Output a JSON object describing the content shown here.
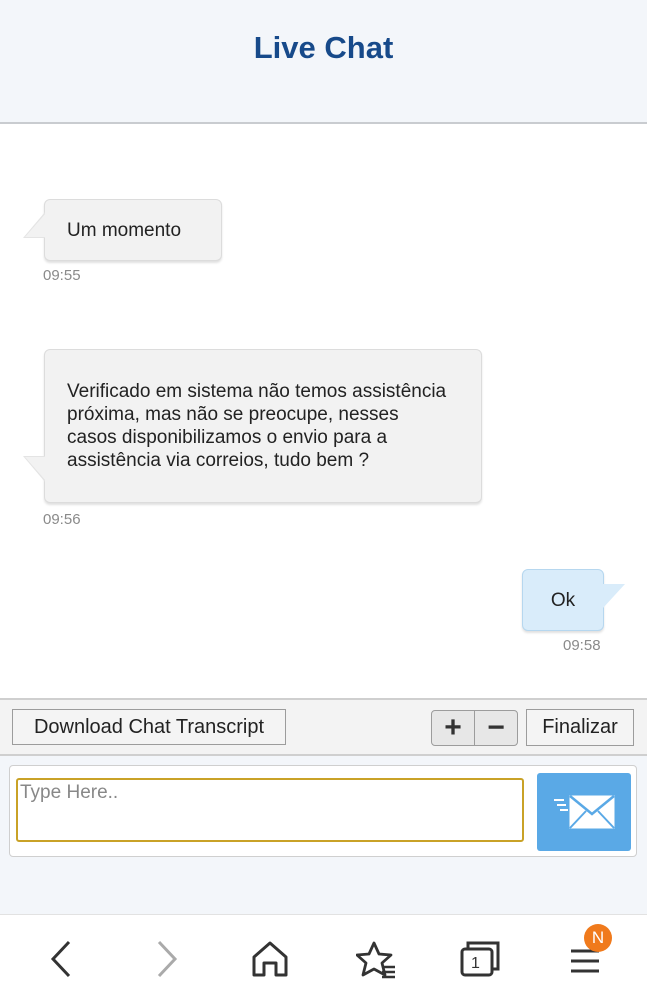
{
  "header": {
    "title": "Live Chat"
  },
  "messages": [
    {
      "sender": "agent",
      "text": "Um momento",
      "time": "09:55"
    },
    {
      "sender": "agent",
      "text": "Verificado em sistema não temos assistência próxima, mas não se preocupe, nesses casos disponibilizamos o envio para a assistência via correios, tudo bem ?",
      "time": "09:56"
    },
    {
      "sender": "user",
      "text": "Ok",
      "time": "09:58"
    }
  ],
  "toolbar": {
    "download_label": "Download Chat Transcript",
    "zoom_in_label": "+",
    "zoom_out_label": "−",
    "end_label": "Finalizar"
  },
  "composer": {
    "placeholder": "Type Here..",
    "value": "",
    "send_icon": "send-mail-icon"
  },
  "browser_nav": {
    "icons": [
      "back-icon",
      "forward-icon",
      "home-icon",
      "bookmarks-icon",
      "tabs-icon",
      "menu-icon"
    ],
    "tab_count": "1",
    "menu_badge": "N"
  },
  "colors": {
    "header_title": "#174a8a",
    "user_bubble": "#d9ecfa",
    "send_button": "#5aa9e6",
    "badge": "#f07a1c"
  }
}
